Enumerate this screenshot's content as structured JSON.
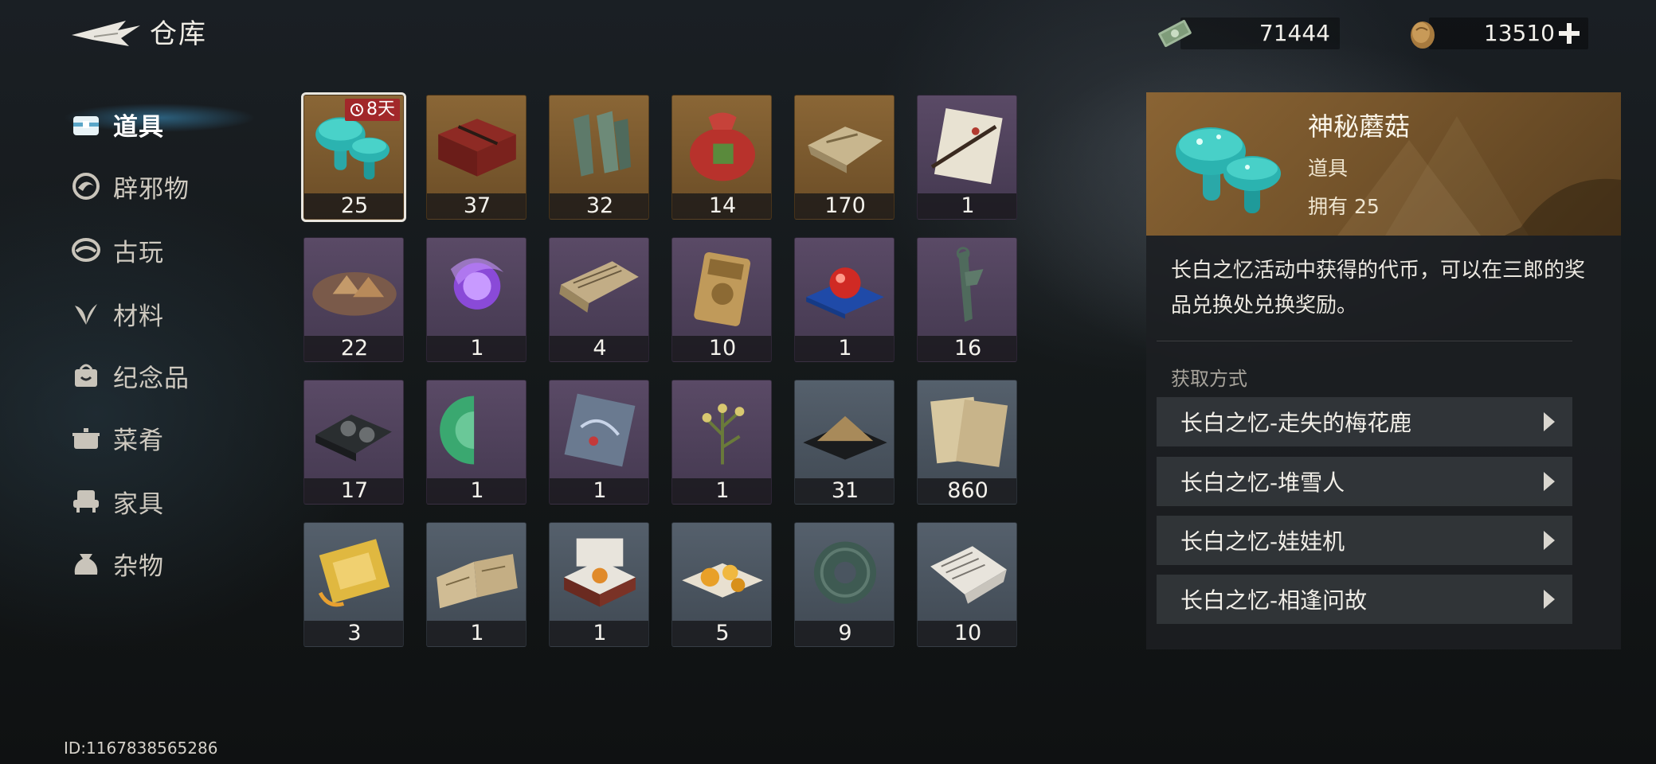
{
  "header": {
    "title": "仓库",
    "currency_cash": {
      "icon": "banknote-icon",
      "value": "71444"
    },
    "currency_coin": {
      "icon": "copper-coin-icon",
      "value": "13510"
    }
  },
  "sidebar": {
    "items": [
      {
        "label": "道具",
        "icon": "chest-icon",
        "active": true
      },
      {
        "label": "辟邪物",
        "icon": "swirl-talisman-icon",
        "active": false
      },
      {
        "label": "古玩",
        "icon": "antique-icon",
        "active": false
      },
      {
        "label": "材料",
        "icon": "leaf-icon",
        "active": false
      },
      {
        "label": "纪念品",
        "icon": "souvenir-bag-icon",
        "active": false
      },
      {
        "label": "菜肴",
        "icon": "dish-pot-icon",
        "active": false
      },
      {
        "label": "家具",
        "icon": "armchair-icon",
        "active": false
      },
      {
        "label": "杂物",
        "icon": "sundries-sack-icon",
        "active": false
      }
    ]
  },
  "user_id": "ID:1167838565286",
  "inventory": {
    "slots": [
      {
        "icon": "teal-mushroom-icon",
        "count": "25",
        "rarity": "gold",
        "badge": "8天",
        "selected": true
      },
      {
        "icon": "red-lacquer-chest-icon",
        "count": "37",
        "rarity": "gold"
      },
      {
        "icon": "bronze-spade-coins-icon",
        "count": "32",
        "rarity": "gold"
      },
      {
        "icon": "red-pouch-icon",
        "count": "14",
        "rarity": "gold"
      },
      {
        "icon": "wrapped-parcel-icon",
        "count": "170",
        "rarity": "gold"
      },
      {
        "icon": "letter-brush-icon",
        "count": "1",
        "rarity": "purple"
      },
      {
        "icon": "pyramid-cake-icon",
        "count": "22",
        "rarity": "purple"
      },
      {
        "icon": "purple-orb-icon",
        "count": "1",
        "rarity": "purple"
      },
      {
        "icon": "old-scroll-icon",
        "count": "4",
        "rarity": "purple"
      },
      {
        "icon": "golden-token-icon",
        "count": "10",
        "rarity": "purple"
      },
      {
        "icon": "red-ball-cushion-icon",
        "count": "1",
        "rarity": "purple"
      },
      {
        "icon": "knife-coin-icon",
        "count": "16",
        "rarity": "purple"
      },
      {
        "icon": "black-box-icon",
        "count": "17",
        "rarity": "purple"
      },
      {
        "icon": "jade-half-disc-icon",
        "count": "1",
        "rarity": "purple"
      },
      {
        "icon": "painted-tile-icon",
        "count": "1",
        "rarity": "purple"
      },
      {
        "icon": "flower-branch-icon",
        "count": "1",
        "rarity": "purple"
      },
      {
        "icon": "sand-pile-tray-icon",
        "count": "31",
        "rarity": "gray"
      },
      {
        "icon": "paper-stack-icon",
        "count": "860",
        "rarity": "gray"
      },
      {
        "icon": "golden-talisman-icon",
        "count": "3",
        "rarity": "gray"
      },
      {
        "icon": "open-book-icon",
        "count": "1",
        "rarity": "gray"
      },
      {
        "icon": "amber-box-icon",
        "count": "1",
        "rarity": "gray"
      },
      {
        "icon": "amber-pieces-icon",
        "count": "5",
        "rarity": "gray"
      },
      {
        "icon": "jade-ring-icon",
        "count": "9",
        "rarity": "gray"
      },
      {
        "icon": "newspaper-icon",
        "count": "10",
        "rarity": "gray"
      }
    ]
  },
  "detail": {
    "icon": "teal-mushroom-icon",
    "name": "神秘蘑菇",
    "type": "道具",
    "owned": "拥有 25",
    "description": "长白之忆活动中获得的代币，可以在三郎的奖品兑换处兑换奖励。",
    "source_title": "获取方式",
    "sources": [
      "长白之忆-走失的梅花鹿",
      "长白之忆-堆雪人",
      "长白之忆-娃娃机",
      "长白之忆-相逢问故"
    ]
  }
}
